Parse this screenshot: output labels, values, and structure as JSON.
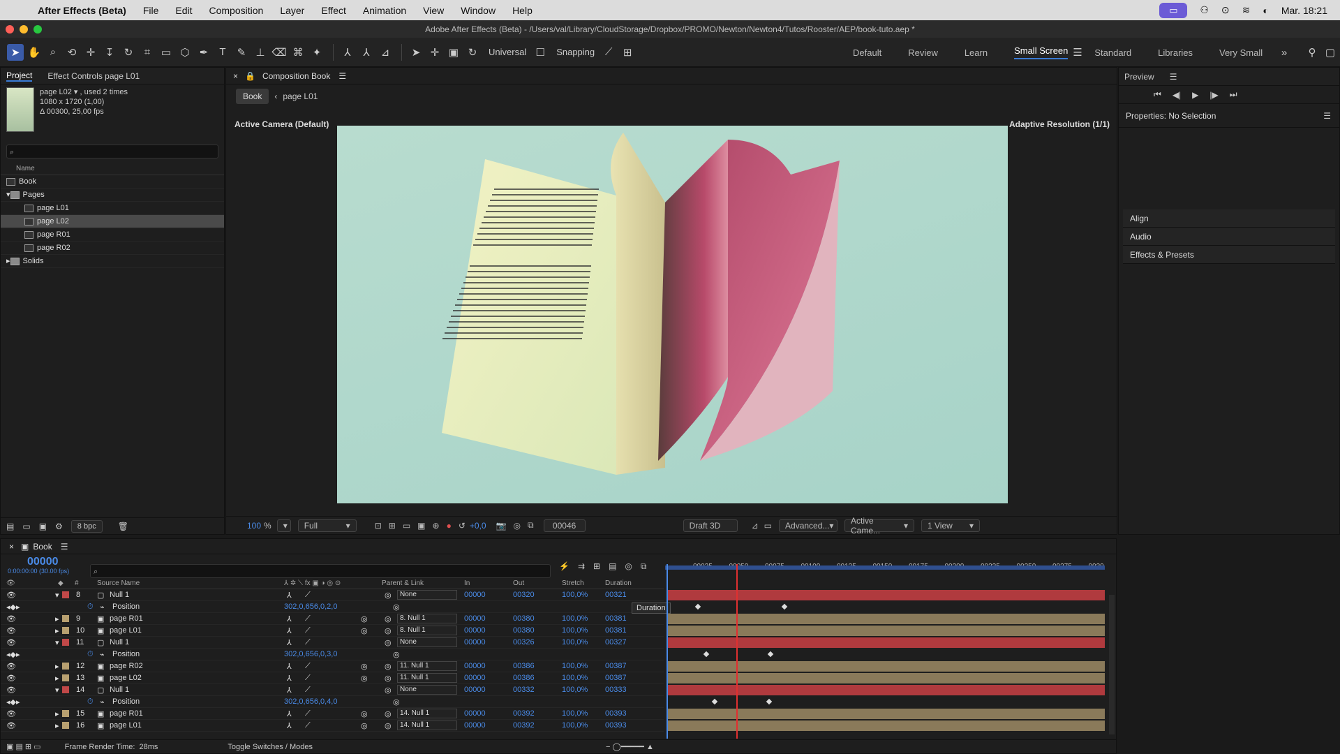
{
  "menubar": {
    "app": "After Effects (Beta)",
    "items": [
      "File",
      "Edit",
      "Composition",
      "Layer",
      "Effect",
      "Animation",
      "View",
      "Window",
      "Help"
    ],
    "clock": "Mar. 18:21"
  },
  "window": {
    "title": "Adobe After Effects (Beta) - /Users/val/Library/CloudStorage/Dropbox/PROMO/Newton/Newton4/Tutos/Rooster/AEP/book-tuto.aep *"
  },
  "toolbar": {
    "axis_mode": "Universal",
    "snapping": "Snapping"
  },
  "workspaces": [
    "Default",
    "Review",
    "Learn",
    "Small Screen",
    "Standard",
    "Libraries",
    "Very Small"
  ],
  "project": {
    "tab": "Project",
    "tab2": "Effect Controls page L01",
    "item": "page L02 ▾ , used 2 times",
    "dims": "1080 x 1720 (1,00)",
    "dur": "Δ 00300, 25,00 fps",
    "col_name": "Name",
    "items": [
      {
        "name": "Book",
        "type": "comp"
      },
      {
        "name": "Pages",
        "type": "folder"
      },
      {
        "name": "page L01",
        "type": "comp"
      },
      {
        "name": "page L02",
        "type": "comp"
      },
      {
        "name": "page R01",
        "type": "comp"
      },
      {
        "name": "page R02",
        "type": "comp"
      },
      {
        "name": "Solids",
        "type": "folder"
      }
    ],
    "bpc": "8 bpc"
  },
  "comp": {
    "tab": "Composition Book",
    "crumb1": "Book",
    "crumb2": "page L01",
    "camera": "Active Camera (Default)",
    "resolution": "Adaptive Resolution (1/1)",
    "zoom": "100",
    "zoom_unit": "%",
    "quality": "Full",
    "exposure": "+0,0",
    "timecode": "00046",
    "renderer": "Draft 3D",
    "advanced": "Advanced...",
    "view": "Active Came...",
    "layout": "1 View"
  },
  "preview": {
    "title": "Preview"
  },
  "properties": {
    "title": "Properties: No Selection",
    "sections": [
      "Align",
      "Audio",
      "Effects & Presets"
    ]
  },
  "timeline": {
    "tab": "Book",
    "time": "00000",
    "time_sub": "0:00:00:00 (30.00 fps)",
    "cols": {
      "source": "Source Name",
      "parent": "Parent & Link",
      "in": "In",
      "out": "Out",
      "stretch": "Stretch",
      "duration": "Duration"
    },
    "tooltip": "Duration",
    "ruler": [
      "00025",
      "00050",
      "00075",
      "00100",
      "00125",
      "00150",
      "00175",
      "00200",
      "00225",
      "00250",
      "00275",
      "0030"
    ],
    "layers": [
      {
        "num": "8",
        "name": "Null 1",
        "parent": "None",
        "in": "00000",
        "out": "00320",
        "stretch": "100,0%",
        "dur": "00321",
        "type": "null"
      },
      {
        "prop": "Position",
        "value": "302,0,656,0,2,0"
      },
      {
        "num": "9",
        "name": "page R01",
        "parent": "8. Null 1",
        "in": "00000",
        "out": "00380",
        "stretch": "100,0%",
        "dur": "00381",
        "type": "comp"
      },
      {
        "num": "10",
        "name": "page L01",
        "parent": "8. Null 1",
        "in": "00000",
        "out": "00380",
        "stretch": "100,0%",
        "dur": "00381",
        "type": "comp"
      },
      {
        "num": "11",
        "name": "Null 1",
        "parent": "None",
        "in": "00000",
        "out": "00326",
        "stretch": "100,0%",
        "dur": "00327",
        "type": "null"
      },
      {
        "prop": "Position",
        "value": "302,0,656,0,3,0"
      },
      {
        "num": "12",
        "name": "page R02",
        "parent": "11. Null 1",
        "in": "00000",
        "out": "00386",
        "stretch": "100,0%",
        "dur": "00387",
        "type": "comp"
      },
      {
        "num": "13",
        "name": "page L02",
        "parent": "11. Null 1",
        "in": "00000",
        "out": "00386",
        "stretch": "100,0%",
        "dur": "00387",
        "type": "comp"
      },
      {
        "num": "14",
        "name": "Null 1",
        "parent": "None",
        "in": "00000",
        "out": "00332",
        "stretch": "100,0%",
        "dur": "00333",
        "type": "null"
      },
      {
        "prop": "Position",
        "value": "302,0,656,0,4,0"
      },
      {
        "num": "15",
        "name": "page R01",
        "parent": "14. Null 1",
        "in": "00000",
        "out": "00392",
        "stretch": "100,0%",
        "dur": "00393",
        "type": "comp"
      },
      {
        "num": "16",
        "name": "page L01",
        "parent": "14. Null 1",
        "in": "00000",
        "out": "00392",
        "stretch": "100,0%",
        "dur": "00393",
        "type": "comp"
      }
    ],
    "footer_left": "Frame Render Time:",
    "footer_time": "28ms",
    "footer_mid": "Toggle Switches / Modes"
  },
  "colors": {
    "accent": "#3a7bd5",
    "null_bar": "#b03a3e",
    "comp_bar": "#8a7a5a",
    "playhead": "#e03030"
  }
}
